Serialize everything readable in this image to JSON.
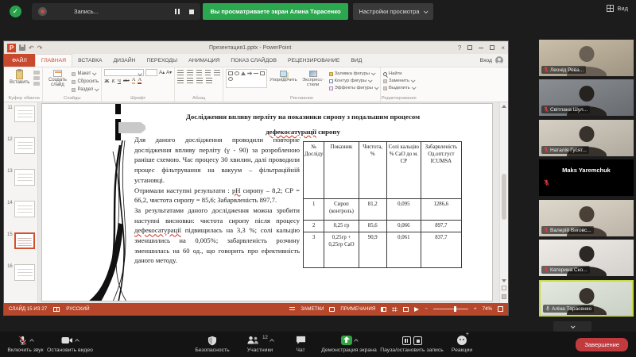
{
  "colors": {
    "ppt_accent": "#b7472a",
    "zoom_green": "#2ba84f",
    "end_red": "#c03a3e",
    "active_speaker_border": "#c9da48",
    "muted_mic_red": "#d64040"
  },
  "top_bar": {
    "recording_label": "Запись...",
    "viewing_banner": "Вы просматриваете экран Алина Тарасенко",
    "view_settings_label": "Настройки просмотра",
    "view_label": "Вид"
  },
  "powerpoint": {
    "window_title": "Презентация1.pptx - PowerPoint",
    "sign_in_label": "Вход",
    "tabs": [
      "ФАЙЛ",
      "ГЛАВНАЯ",
      "ВСТАВКА",
      "ДИЗАЙН",
      "ПЕРЕХОДЫ",
      "АНИМАЦИЯ",
      "ПОКАЗ СЛАЙДОВ",
      "РЕЦЕНЗИРОВАНИЕ",
      "ВИД"
    ],
    "ribbon": {
      "paste_label": "Вставить",
      "new_slide_label": "Создать слайд",
      "layout_label": "Макет",
      "reset_label": "Сбросить",
      "section_label": "Раздел",
      "bold_letter": "Ж",
      "italic_letter": "К",
      "underline_letter": "Ч",
      "strike_letters": "abc",
      "font_color_letter": "А",
      "arrange_label": "Упорядочить",
      "quick_styles_label": "Экспресс-стили",
      "shape_fill_label": "Заливка фигуры",
      "shape_outline_label": "Контур фигуры",
      "shape_effects_label": "Эффекты фигуры",
      "find_label": "Найти",
      "replace_label": "Заменить",
      "select_label": "Выделить",
      "group_labels": [
        "Буфер обмена",
        "Слайды",
        "Шрифт",
        "Абзац",
        "Рисование",
        "Редактирование"
      ]
    },
    "thumbnail_numbers": [
      "11",
      "12",
      "13",
      "14",
      "15",
      "16"
    ],
    "slide": {
      "title_line1": "Дослідження впливу перліту на показники сиропу з подальшим процесом",
      "title_word_misspelled": "дефекосатурації",
      "title_line2_rest": " сиропу",
      "para1": "Для даного дослідження проводили повторне дослідження впливу перліту (γ - 90) за розробленою раніше схемою. Час процесу 30 хвилин, далі проводили процес фільтрування на вакуум – фільтраційній установці.",
      "para2_lead": "Отримали наступні результати : ",
      "para2_ph": "pH",
      "para2_rest": " сиропу – 8,2; СР = 66,2, чистота сиропу = 85,6; Забарвленість 897,7.",
      "para3_lead": "За результатами даного дослідження можна зробити наступні висновки: чистота сиропу після процесу ",
      "para3_word": "дефекосатурації",
      "para3_rest": " підвищилась на 3,3 %; солі кальцію зменшились на 0,005%; забарвленість розчину зменшилась на 60 од., що говорить про ефективність даного методу.",
      "table": {
        "headers": [
          "№ Досліду",
          "Показник",
          "Чистота, %",
          "Солі кальцію % СаО до м. СР",
          "Забарвленість Од.опт.густ ICUMSA"
        ],
        "rows": [
          [
            "1",
            "Сироп (контроль)",
            "81,2",
            "0,095",
            "1286,6"
          ],
          [
            "2",
            "0,25 гр",
            "85,6",
            "0,066",
            "897,7"
          ],
          [
            "3",
            "0,25гр + 0,25гр СаО",
            "90,9",
            "0,061",
            "837,7"
          ]
        ]
      }
    },
    "status_bar": {
      "slide_counter": "СЛАЙД 15 ИЗ 27",
      "language": "РУССКИЙ",
      "notes_label": "ЗАМЕТКИ",
      "comments_label": "ПРИМЕЧАНИЯ",
      "zoom_percent": "74%"
    }
  },
  "participants": [
    {
      "name": "Леонід Рева..."
    },
    {
      "name": "Світлана Шул..."
    },
    {
      "name": "Наталія Гусят..."
    },
    {
      "name": "Maks Yaremchuk"
    },
    {
      "name": "Валерій Виговс..."
    },
    {
      "name": "Катерина Ско..."
    },
    {
      "name": "Аліна Тарасенко"
    }
  ],
  "toolbar": {
    "unmute_label": "Включить звук",
    "stop_video_label": "Остановить видео",
    "security_label": "Безопасность",
    "participants_label": "Участники",
    "participants_count": "12",
    "chat_label": "Чат",
    "share_label": "Демонстрация экрана",
    "recording_controls_label": "Пауза/остановить запись",
    "reactions_label": "Реакции",
    "end_label": "Завершение"
  }
}
